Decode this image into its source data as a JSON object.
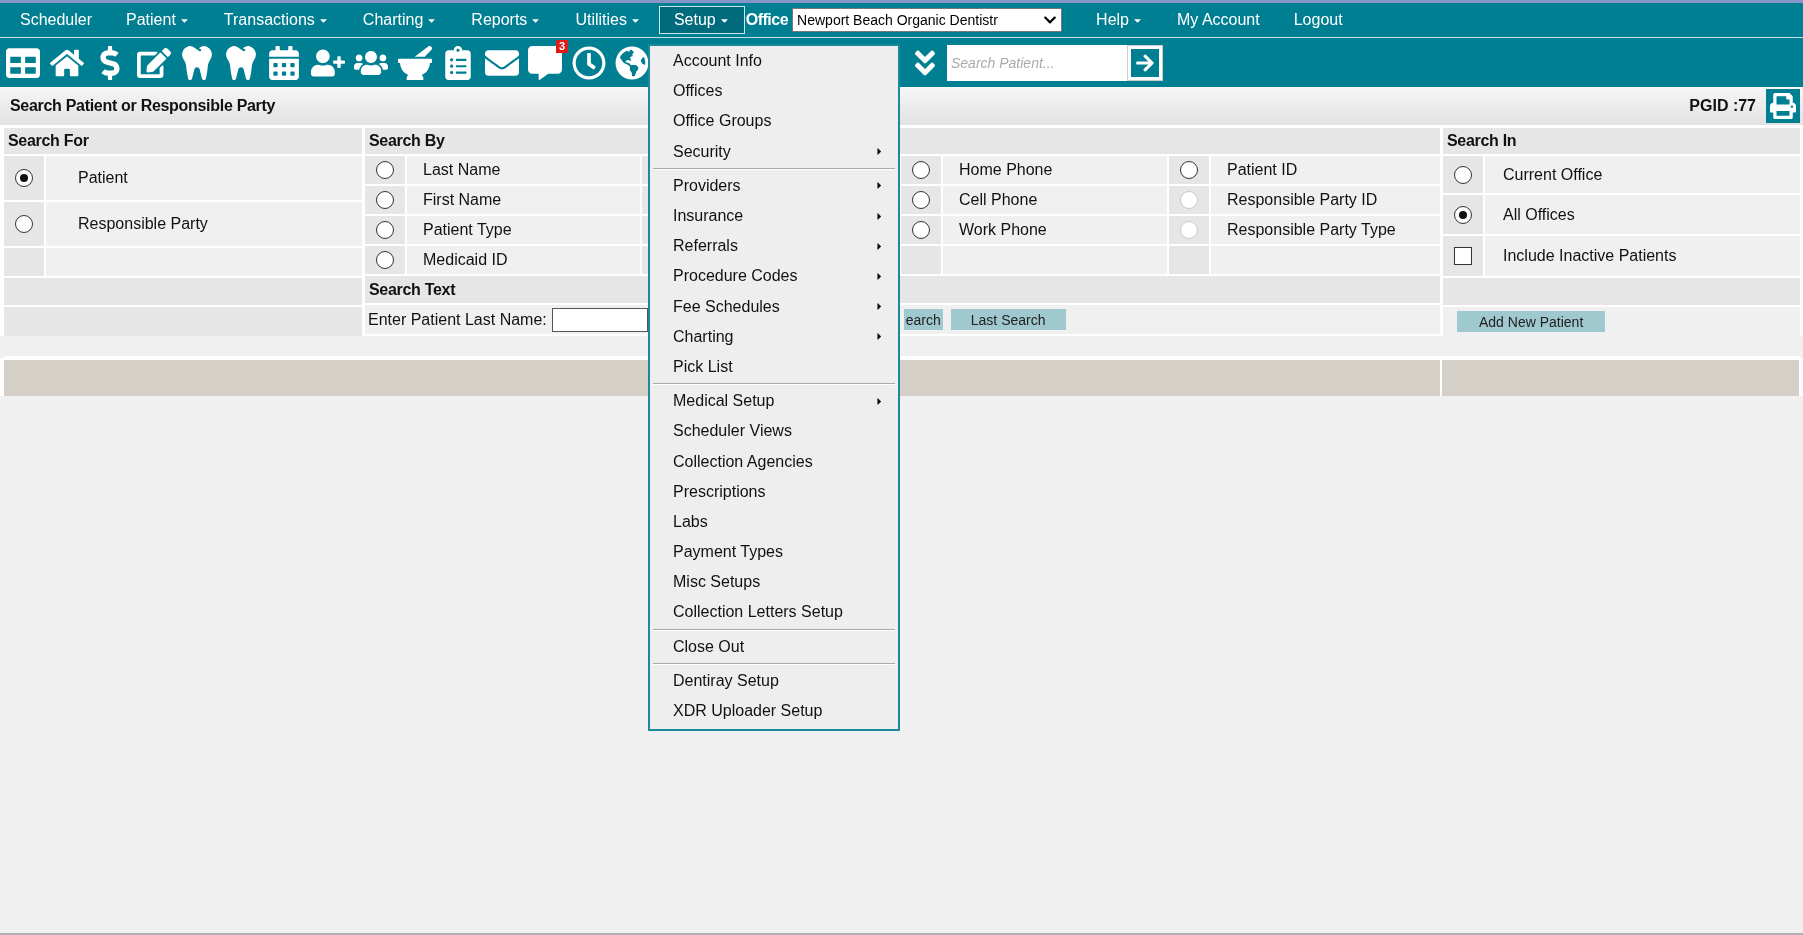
{
  "menu_bar": {
    "left_items": [
      {
        "label": "Scheduler",
        "has_caret": false,
        "selected": false
      },
      {
        "label": "Patient",
        "has_caret": true,
        "selected": false
      },
      {
        "label": "Transactions",
        "has_caret": true,
        "selected": false
      },
      {
        "label": "Charting",
        "has_caret": true,
        "selected": false
      },
      {
        "label": "Reports",
        "has_caret": true,
        "selected": false
      },
      {
        "label": "Utilities",
        "has_caret": true,
        "selected": false
      },
      {
        "label": "Setup",
        "has_caret": true,
        "selected": true
      }
    ],
    "office": {
      "label": "Office",
      "value": "Newport Beach Organic Dentistr"
    },
    "right_items": [
      {
        "label": "Help",
        "has_caret": true,
        "selected": false
      },
      {
        "label": "My Account",
        "has_caret": false,
        "selected": false
      },
      {
        "label": "Logout",
        "has_caret": false,
        "selected": false
      }
    ]
  },
  "toolbar": {
    "message_badge": "3",
    "search": {
      "placeholder": "Search Patient..."
    }
  },
  "page": {
    "title": "Search Patient or Responsible Party",
    "pgid": "PGID :77"
  },
  "search_for": {
    "header": "Search For",
    "options": [
      {
        "label": "Patient",
        "selected": true
      },
      {
        "label": "Responsible Party",
        "selected": false
      }
    ]
  },
  "search_by": {
    "header": "Search By",
    "columns": [
      [
        {
          "label": "Last Name",
          "selected": false,
          "disabled": false
        },
        {
          "label": "First Name",
          "selected": false,
          "disabled": false
        },
        {
          "label": "Patient Type",
          "selected": false,
          "disabled": false
        },
        {
          "label": "Medicaid ID",
          "selected": false,
          "disabled": false
        }
      ],
      [
        {
          "label": "Home Phone",
          "selected": false,
          "disabled": false
        },
        {
          "label": "Cell Phone",
          "selected": false,
          "disabled": false
        },
        {
          "label": "Work Phone",
          "selected": false,
          "disabled": false
        }
      ],
      [
        {
          "label": "Patient ID",
          "selected": false,
          "disabled": false
        },
        {
          "label": "Responsible Party ID",
          "selected": false,
          "disabled": true
        },
        {
          "label": "Responsible Party Type",
          "selected": false,
          "disabled": true
        }
      ]
    ]
  },
  "search_text": {
    "header": "Search Text",
    "label": "Enter Patient Last Name:",
    "buttons": [
      "earch",
      "Last Search"
    ]
  },
  "search_in": {
    "header": "Search In",
    "options": [
      {
        "label": "Current Office",
        "selected": false
      },
      {
        "label": "All Offices",
        "selected": true
      }
    ],
    "include_inactive": {
      "label": "Include Inactive Patients",
      "checked": false
    },
    "add_button": "Add New Patient"
  },
  "setup_menu": {
    "groups": [
      [
        {
          "label": "Account Info",
          "submenu": false
        },
        {
          "label": "Offices",
          "submenu": false
        },
        {
          "label": "Office Groups",
          "submenu": false
        },
        {
          "label": "Security",
          "submenu": true
        }
      ],
      [
        {
          "label": "Providers",
          "submenu": true
        },
        {
          "label": "Insurance",
          "submenu": true
        },
        {
          "label": "Referrals",
          "submenu": true
        },
        {
          "label": "Procedure Codes",
          "submenu": true
        },
        {
          "label": "Fee Schedules",
          "submenu": true
        },
        {
          "label": "Charting",
          "submenu": true
        },
        {
          "label": "Pick List",
          "submenu": false
        }
      ],
      [
        {
          "label": "Medical Setup",
          "submenu": true
        },
        {
          "label": "Scheduler Views",
          "submenu": false
        },
        {
          "label": "Collection Agencies",
          "submenu": false
        },
        {
          "label": "Prescriptions",
          "submenu": false
        },
        {
          "label": "Labs",
          "submenu": false
        },
        {
          "label": "Payment Types",
          "submenu": false
        },
        {
          "label": "Misc Setups",
          "submenu": false
        },
        {
          "label": "Collection Letters Setup",
          "submenu": false
        }
      ],
      [
        {
          "label": "Close Out",
          "submenu": false
        }
      ],
      [
        {
          "label": "Dentiray Setup",
          "submenu": false
        },
        {
          "label": "XDR Uploader Setup",
          "submenu": false
        }
      ]
    ]
  }
}
